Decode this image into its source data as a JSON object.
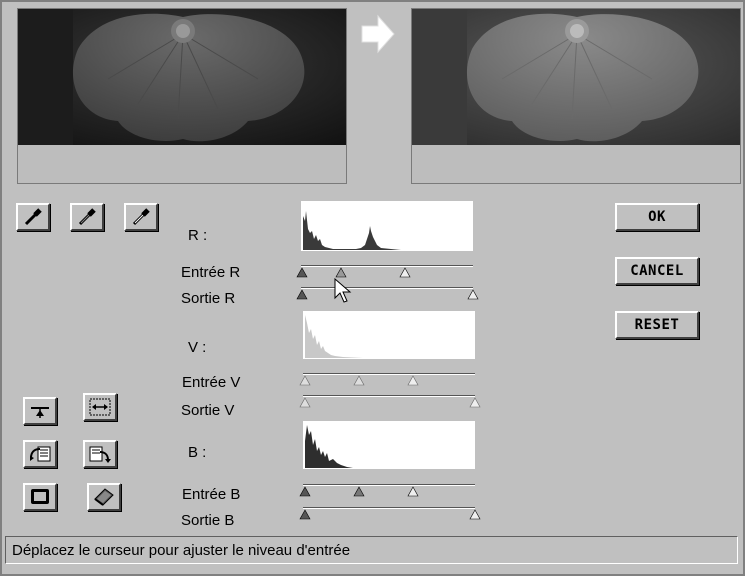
{
  "buttons": {
    "ok": "OK",
    "cancel": "CANCEL",
    "reset": "RESET"
  },
  "channels": {
    "r": {
      "label": "R :",
      "input": "Entrée R",
      "output": "Sortie R"
    },
    "v": {
      "label": "V :",
      "input": "Entrée V",
      "output": "Sortie V"
    },
    "b": {
      "label": "B :",
      "input": "Entrée B",
      "output": "Sortie B"
    }
  },
  "status_text": "Déplacez le curseur pour ajuster le niveau d'entrée",
  "icons": {
    "eyedroppers": [
      "eyedropper-black-icon",
      "eyedropper-gray-icon",
      "eyedropper-white-icon"
    ],
    "tools": [
      "balance-icon",
      "levels-icon",
      "load-icon",
      "save-icon",
      "monitor-icon",
      "book-icon"
    ],
    "arrow": "arrow-right-icon"
  },
  "colors": {
    "background": "#c0c0c0",
    "histogram_bg": "#ffffff"
  }
}
